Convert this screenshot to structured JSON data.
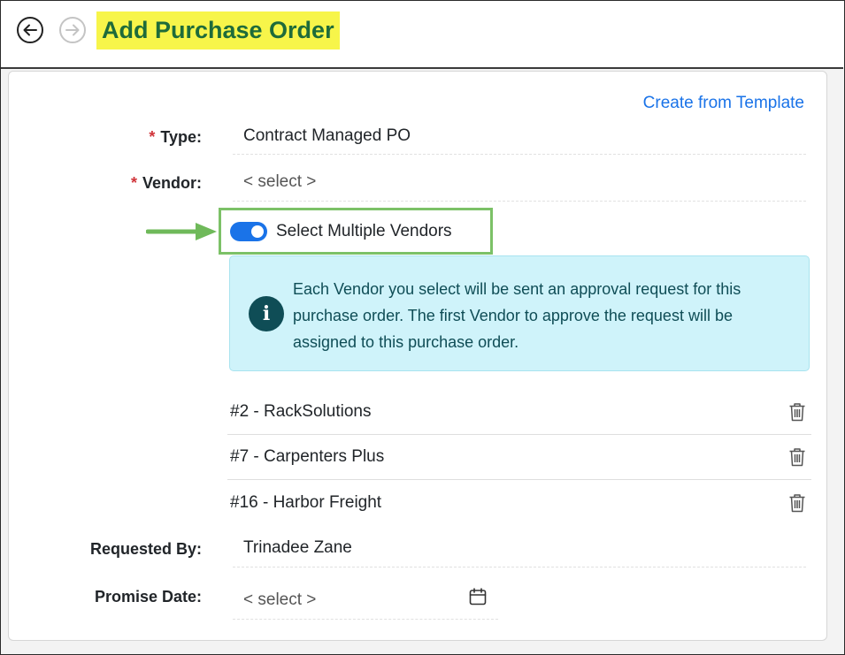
{
  "header": {
    "title": "Add Purchase Order",
    "back_icon": "arrow-left-circle-icon",
    "forward_icon": "arrow-right-circle-icon"
  },
  "form": {
    "template_link": "Create from Template",
    "required_marker": "*",
    "type": {
      "label": "Type:",
      "value": "Contract Managed PO"
    },
    "vendor": {
      "label": "Vendor:",
      "placeholder": "< select >"
    },
    "multiple_vendors": {
      "label": "Select Multiple Vendors",
      "enabled": true
    },
    "info": {
      "icon": "info-circle-icon",
      "glyph": "i",
      "text": "Each Vendor you select will be sent an approval request for this purchase order. The first Vendor to approve the request will be assigned to this purchase order."
    },
    "vendors": [
      {
        "name": "#2 - RackSolutions"
      },
      {
        "name": "#7 - Carpenters Plus"
      },
      {
        "name": "#16 - Harbor Freight"
      }
    ],
    "requested_by": {
      "label": "Requested By:",
      "value": "Trinadee Zane"
    },
    "promise_date": {
      "label": "Promise Date:",
      "placeholder": "< select >",
      "icon": "calendar-icon"
    }
  },
  "colors": {
    "accent": "#1a73e8",
    "title_highlight": "#f7f54a",
    "title_text": "#1e6b3a",
    "info_bg": "#cff3fa",
    "info_text": "#0f4d56",
    "required": "#d0343a",
    "callout_green": "#7cc167"
  }
}
